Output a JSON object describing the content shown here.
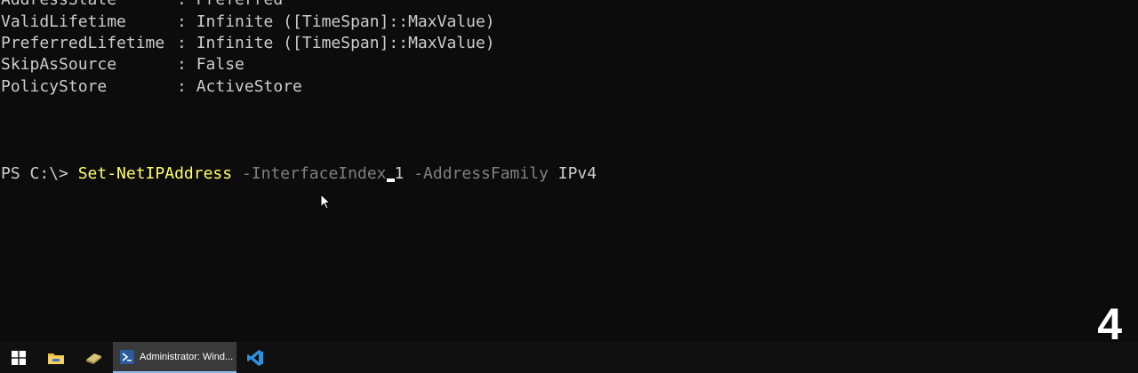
{
  "console": {
    "properties": [
      {
        "name": "AddressState",
        "sep": ": ",
        "value": "Preferred"
      },
      {
        "name": "ValidLifetime",
        "sep": ": ",
        "value": "Infinite ([TimeSpan]::MaxValue)"
      },
      {
        "name": "PreferredLifetime",
        "sep": ": ",
        "value": "Infinite ([TimeSpan]::MaxValue)"
      },
      {
        "name": "SkipAsSource",
        "sep": ": ",
        "value": "False"
      },
      {
        "name": "PolicyStore",
        "sep": ": ",
        "value": "ActiveStore"
      }
    ],
    "prompt": "PS C:\\> ",
    "cmdlet": "Set-NetIPAddress",
    "param1": "-InterfaceIndex",
    "arg1": "1",
    "param2": "-AddressFamily",
    "arg2": "IPv4"
  },
  "step_badge": "4",
  "taskbar": {
    "start_icon": "windows-logo-icon",
    "file_explorer_icon": "folder-icon",
    "tool_icon": "eraser-icon",
    "active_app_label": "Administrator: Wind...",
    "active_app_icon": "powershell-icon",
    "vscode_icon": "vscode-icon"
  },
  "colors": {
    "background": "#0c0c0c",
    "text": "#cccccc",
    "cmdlet": "#ffff66",
    "param": "#808080",
    "taskbar": "#101010"
  }
}
